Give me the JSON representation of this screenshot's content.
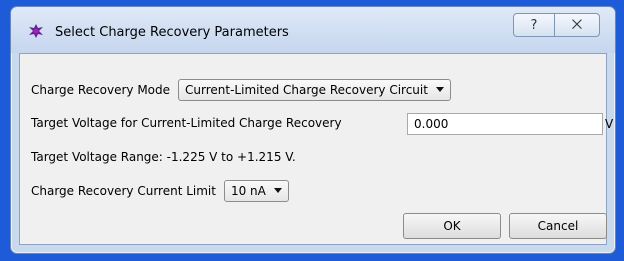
{
  "window": {
    "title": "Select Charge Recovery Parameters",
    "help_label": "?",
    "close_label": "⨉",
    "icon": "app-icon",
    "icon_color": "#6a1b9a"
  },
  "form": {
    "mode_label": "Charge Recovery Mode",
    "mode_value": "Current-Limited Charge Recovery Circuit",
    "voltage_label": "Target Voltage for Current-Limited Charge Recovery",
    "voltage_value": "0.000",
    "voltage_unit": "V",
    "range_text": "Target Voltage Range: -1.225 V to +1.215 V.",
    "current_label": "Charge Recovery Current Limit",
    "current_value": "10 nA"
  },
  "buttons": {
    "ok": "OK",
    "cancel": "Cancel"
  }
}
